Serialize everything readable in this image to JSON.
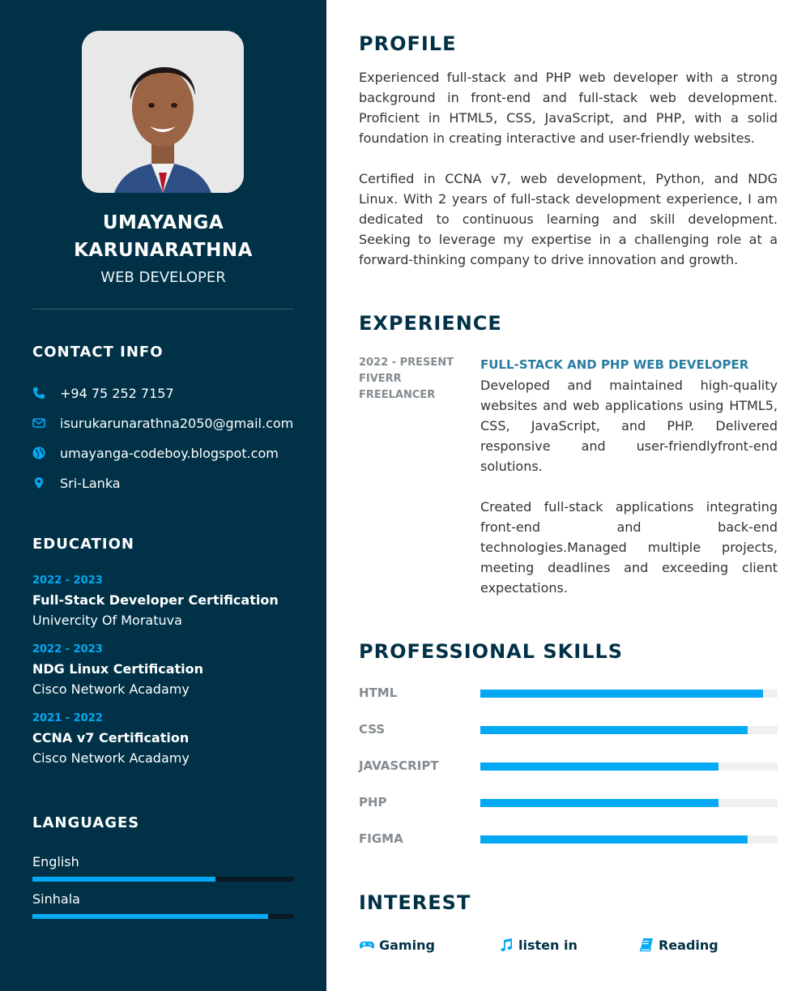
{
  "profile": {
    "name_line1": "UMAYANGA",
    "name_line2": "KARUNARATHNA",
    "role": "WEB DEVELOPER"
  },
  "contact": {
    "heading": "CONTACT INFO",
    "items": [
      {
        "icon": "phone-icon",
        "text": "+94 75 252 7157"
      },
      {
        "icon": "envelope-icon",
        "text": "isurukarunarathna2050@gmail.com"
      },
      {
        "icon": "globe-icon",
        "text": "umayanga-codeboy.blogspot.com"
      },
      {
        "icon": "map-marker-icon",
        "text": "Sri-Lanka"
      }
    ]
  },
  "education": {
    "heading": "EDUCATION",
    "items": [
      {
        "years": "2022 - 2023",
        "degree": "Full-Stack Developer Certification",
        "school": "Univercity Of Moratuva"
      },
      {
        "years": "2022 - 2023",
        "degree": "NDG Linux Certification",
        "school": "Cisco Network Acadamy"
      },
      {
        "years": "2021 - 2022",
        "degree": "CCNA v7 Certification",
        "school": "Cisco Network Acadamy"
      }
    ]
  },
  "languages": {
    "heading": "LANGUAGES",
    "items": [
      {
        "name": "English",
        "level": 0.7
      },
      {
        "name": "Sinhala",
        "level": 0.9
      }
    ]
  },
  "about": {
    "heading": "PROFILE",
    "paragraphs": [
      "Experienced full-stack and PHP web developer with a strong background in front-end and full-stack web development. Proficient in HTML5, CSS, JavaScript, and PHP, with a solid foundation in creating interactive and user-friendly websites.",
      "Certified in CCNA v7, web development, Python, and NDG Linux. With 2 years of full-stack development experience, I am dedicated to continuous learning and skill development. Seeking to leverage my expertise in a challenging role at a forward-thinking company to drive innovation and growth."
    ]
  },
  "experience": {
    "heading": "EXPERIENCE",
    "items": [
      {
        "period": "2022 - PRESENT",
        "company": "FIVERR FREELANCER",
        "title": "FULL-STACK AND PHP WEB DEVELOPER",
        "paragraphs": [
          "Developed and maintained high-quality websites and web applications using HTML5, CSS, JavaScript, and PHP. Delivered responsive and user-friendlyfront-end solutions.",
          "Created full-stack applications integrating front-end and back-end technologies.Managed multiple projects, meeting deadlines and exceeding client expectations."
        ]
      }
    ]
  },
  "skills": {
    "heading": "PROFESSIONAL SKILLS",
    "items": [
      {
        "name": "HTML",
        "level": 0.95
      },
      {
        "name": "CSS",
        "level": 0.9
      },
      {
        "name": "JAVASCRIPT",
        "level": 0.8
      },
      {
        "name": "PHP",
        "level": 0.8
      },
      {
        "name": "FIGMA",
        "level": 0.9
      }
    ]
  },
  "interests": {
    "heading": "INTEREST",
    "items": [
      {
        "icon": "gamepad-icon",
        "text": "Gaming"
      },
      {
        "icon": "music-note-icon",
        "text": "listen in"
      },
      {
        "icon": "book-icon",
        "text": "Reading"
      }
    ]
  },
  "colors": {
    "sidebar": "#003147",
    "accent": "#03a9f4",
    "heading": "#003147",
    "job_title": "#2a7da2"
  }
}
